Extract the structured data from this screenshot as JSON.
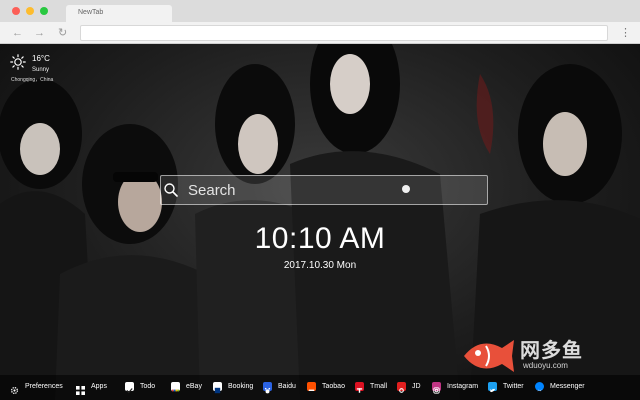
{
  "browser": {
    "tab_title": "NewTab"
  },
  "weather": {
    "temperature": "16°C",
    "condition": "Sunny",
    "location": "Chongqing，China"
  },
  "search": {
    "placeholder": "Search"
  },
  "clock": {
    "time": "10:10 AM",
    "date": "2017.10.30 Mon"
  },
  "logo": {
    "name": "网多鱼",
    "domain": "wduoyu.com"
  },
  "bottom_bar": {
    "items": [
      {
        "label": "Preferences",
        "icon": "gear-icon",
        "color": "#000000"
      },
      {
        "label": "Apps",
        "icon": "apps-grid-icon",
        "color": "#000000"
      },
      {
        "label": "Todo",
        "icon": "checkbox-icon",
        "color": "#ffffff"
      },
      {
        "label": "eBay",
        "icon": "ebay-icon",
        "color": "#ffffff"
      },
      {
        "label": "Booking",
        "icon": "booking-icon",
        "color": "#ffffff"
      },
      {
        "label": "Baidu",
        "icon": "baidu-icon",
        "color": "#2b63e4"
      },
      {
        "label": "Taobao",
        "icon": "taobao-icon",
        "color": "#ff5000"
      },
      {
        "label": "Tmall",
        "icon": "tmall-icon",
        "color": "#dd1122"
      },
      {
        "label": "JD",
        "icon": "jd-icon",
        "color": "#e21f1f"
      },
      {
        "label": "Instagram",
        "icon": "instagram-icon",
        "color": "#c13584"
      },
      {
        "label": "Twitter",
        "icon": "twitter-icon",
        "color": "#1da1f2"
      },
      {
        "label": "Messenger",
        "icon": "messenger-icon",
        "color": "#0084ff"
      }
    ]
  }
}
